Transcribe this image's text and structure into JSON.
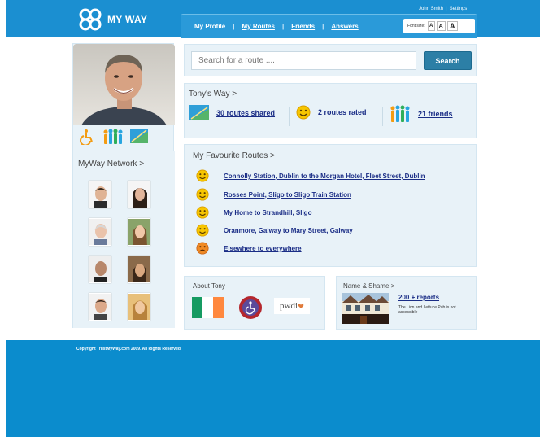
{
  "header": {
    "logo_text": "MY WAY",
    "user_link": "John Smith",
    "settings_link": "Settings",
    "nav": [
      "My Profile",
      "My Routes",
      "Friends",
      "Answers"
    ],
    "font_size_label": "Font size:",
    "font_sizes": [
      "A",
      "A",
      "A"
    ]
  },
  "search": {
    "placeholder": "Search for a route ....",
    "button_label": "Search"
  },
  "sidebar": {
    "network_title": "MyWay Network >"
  },
  "tonys_way": {
    "title": "Tony's Way >",
    "routes_shared": "30 routes shared",
    "routes_rated": "2 routes rated",
    "friends": "21 friends"
  },
  "favourites": {
    "title": "My Favourite Routes >",
    "routes": [
      {
        "label": "Connolly Station, Dublin to the Morgan Hotel, Fleet Street, Dublin",
        "mood": "happy"
      },
      {
        "label": "Rosses Point, Sligo to Sligo Train Station",
        "mood": "happy"
      },
      {
        "label": "My Home to Strandhill, Sligo",
        "mood": "happy"
      },
      {
        "label": "Oranmore, Galway to Mary Street, Galway",
        "mood": "happy"
      },
      {
        "label": "Elsewhere to everywhere",
        "mood": "sad"
      }
    ]
  },
  "about": {
    "title": "About Tony",
    "pwdi_text": "pwdi"
  },
  "name_shame": {
    "title": "Name & Shame >",
    "reports_link": "200 + reports",
    "description": "The Lion and Lettuce Pub is not accessible"
  },
  "footer": {
    "copyright": "Copyright TrustMyWay.com 2009. All Rights Reserved"
  },
  "colors": {
    "brand_blue": "#1b8fd1",
    "footer_blue": "#0b8ccd",
    "link_navy": "#1a2d86",
    "panel_bg": "#e8f2f8",
    "search_button": "#2c7fa6"
  }
}
